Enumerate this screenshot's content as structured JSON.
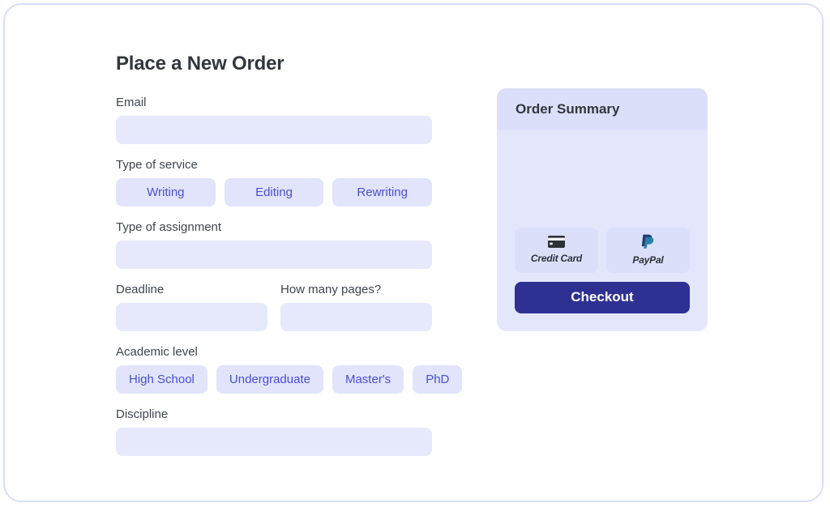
{
  "page": {
    "title": "Place a New Order"
  },
  "form": {
    "email": {
      "label": "Email",
      "value": "",
      "placeholder": ""
    },
    "service": {
      "label": "Type of service",
      "options": [
        "Writing",
        "Editing",
        "Rewriting"
      ]
    },
    "assignment": {
      "label": "Type of assignment",
      "value": "",
      "placeholder": ""
    },
    "deadline": {
      "label": "Deadline",
      "value": "",
      "placeholder": ""
    },
    "pages": {
      "label": "How many pages?",
      "value": "",
      "placeholder": ""
    },
    "academic_level": {
      "label": "Academic level",
      "options": [
        "High School",
        "Undergraduate",
        "Master's",
        "PhD"
      ]
    },
    "discipline": {
      "label": "Discipline",
      "value": "",
      "placeholder": ""
    }
  },
  "summary": {
    "title": "Order Summary",
    "line_items": [],
    "payment_methods": [
      {
        "label": "Credit Card",
        "icon": "credit-card-icon"
      },
      {
        "label": "PayPal",
        "icon": "paypal-icon"
      }
    ],
    "checkout_label": "Checkout"
  },
  "colors": {
    "accent": "#4a4fd0",
    "checkout_bg": "#2e3192",
    "input_bg": "#e6e8fc",
    "chip_bg": "#e1e4fb",
    "panel_bg": "#e4e7fc",
    "panel_header_bg": "#dcdffa",
    "frame_border": "#d9ddfb",
    "heading_text": "#33373d",
    "label_text": "#3f4450",
    "paypal_dark": "#1f3d72",
    "paypal_light": "#2a7fa8"
  }
}
